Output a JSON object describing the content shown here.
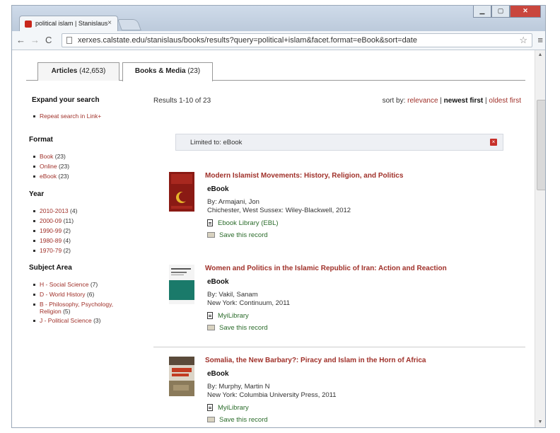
{
  "browser": {
    "tab_title": "political islam | Stanislaus",
    "tab_close": "×",
    "url": "xerxes.calstate.edu/stanislaus/books/results?query=political+islam&facet.format=eBook&sort=date",
    "back": "←",
    "forward": "→",
    "reload": "C",
    "star": "☆",
    "menu": "≡",
    "win_min": "▁",
    "win_max": "▢",
    "win_close": "✕"
  },
  "tabs": [
    {
      "label": "Articles",
      "count": "(42,653)"
    },
    {
      "label": "Books & Media",
      "count": "(23)"
    }
  ],
  "sidebar": {
    "expand_heading": "Expand your search",
    "expand_link": "Repeat search in Link+",
    "format_heading": "Format",
    "format_items": [
      {
        "label": "Book",
        "count": "(23)"
      },
      {
        "label": "Online",
        "count": "(23)"
      },
      {
        "label": "eBook",
        "count": "(23)"
      }
    ],
    "year_heading": "Year",
    "year_items": [
      {
        "label": "2010-2013",
        "count": "(4)"
      },
      {
        "label": "2000-09",
        "count": "(11)"
      },
      {
        "label": "1990-99",
        "count": "(2)"
      },
      {
        "label": "1980-89",
        "count": "(4)"
      },
      {
        "label": "1970-79",
        "count": "(2)"
      }
    ],
    "subject_heading": "Subject Area",
    "subject_items": [
      {
        "label": "H - Social Science",
        "count": "(7)"
      },
      {
        "label": "D - World History",
        "count": "(6)"
      },
      {
        "label": "B - Philosophy, Psychology,",
        "label2": "Religion",
        "count": "(5)"
      },
      {
        "label": "J - Political Science",
        "count": "(3)"
      }
    ]
  },
  "results_header": {
    "count_text": "Results 1-10 of 23",
    "sort_label": "sort by:",
    "sort_relevance": "relevance",
    "sort_newest": "newest first",
    "sort_oldest": "oldest first",
    "sep": "|"
  },
  "filter": {
    "text": "Limited to: eBook",
    "remove": "×"
  },
  "results": [
    {
      "title": "Modern Islamist Movements: History, Religion, and Politics",
      "type": "eBook",
      "by": "By: Armajani, Jon",
      "pub": "Chichester, West Sussex: Wiley-Blackwell, 2012",
      "link": "Ebook Library (EBL)",
      "save": "Save this record"
    },
    {
      "title": "Women and Politics in the Islamic Republic of Iran: Action and Reaction",
      "type": "eBook",
      "by": "By: Vakil, Sanam",
      "pub": "New York: Continuum, 2011",
      "link": "MyiLibrary",
      "save": "Save this record"
    },
    {
      "title": "Somalia, the New Barbary?: Piracy and Islam in the Horn of Africa",
      "type": "eBook",
      "by": "By: Murphy, Martin N",
      "pub": "New York: Columbia University Press, 2011",
      "link": "MyiLibrary",
      "save": "Save this record"
    }
  ],
  "colors": {
    "link": "#a0312a",
    "access": "#2a6b2a",
    "accent": "#c7302a"
  }
}
